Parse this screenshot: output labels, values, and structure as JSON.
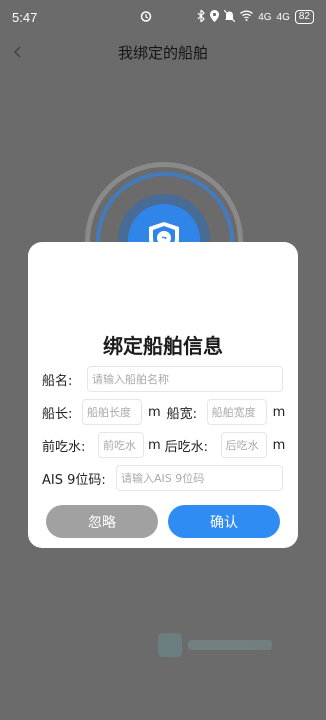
{
  "status_bar": {
    "time": "5:47",
    "battery": "82",
    "signal1": "4G",
    "signal2": "4G"
  },
  "header": {
    "title": "我绑定的船舶"
  },
  "dialog": {
    "title": "绑定船舶信息",
    "ship_name": {
      "label": "船名:",
      "placeholder": "请输入船舶名称",
      "value": ""
    },
    "length": {
      "label": "船长:",
      "placeholder": "船舶长度",
      "unit": "m",
      "value": ""
    },
    "width": {
      "label": "船宽:",
      "placeholder": "船舶宽度",
      "unit": "m",
      "value": ""
    },
    "draft_front": {
      "label": "前吃水:",
      "placeholder": "前吃水",
      "unit": "m",
      "value": ""
    },
    "draft_rear": {
      "label": "后吃水:",
      "placeholder": "后吃水",
      "unit": "m",
      "value": ""
    },
    "ais": {
      "label": "AIS 9位码:",
      "placeholder": "请输入AIS 9位码",
      "value": ""
    },
    "buttons": {
      "ignore": "忽略",
      "confirm": "确认"
    }
  },
  "colors": {
    "overlay": "#6b6b6b",
    "accent": "#2f8cf2",
    "button_secondary": "#a1a1a1"
  },
  "icons": {
    "center_shield": "shield-bulb-icon",
    "back": "chevron-left-icon"
  }
}
